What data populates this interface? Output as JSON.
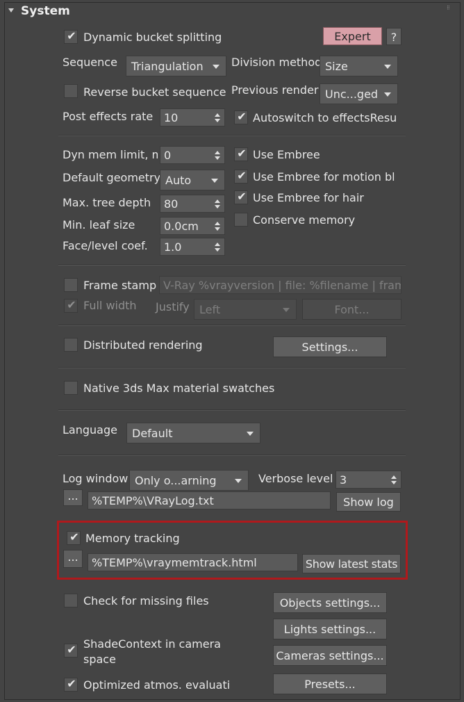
{
  "rollout": {
    "title": "System",
    "collapse_icon": "triangle-down-icon",
    "grip_icon": "drag-grip-icon"
  },
  "colors": {
    "panel": "#444444",
    "expert_button": "#d9a0a8",
    "highlight_box": "#b0191c"
  },
  "bucket": {
    "dynamic_splitting": {
      "label": "Dynamic bucket splitting",
      "checked": true
    },
    "expert_label": "Expert",
    "help_label": "?",
    "sequence": {
      "label": "Sequence",
      "value": "Triangulation"
    },
    "division_method": {
      "label": "Division method",
      "value": "Size"
    },
    "reverse": {
      "label": "Reverse bucket sequence",
      "checked": false
    },
    "previous_render": {
      "label": "Previous render",
      "value": "Unc...ged"
    },
    "post_effects_rate": {
      "label": "Post effects rate",
      "value": "10"
    },
    "autoswitch": {
      "label": "Autoswitch to effectsResult",
      "checked": true
    }
  },
  "memory": {
    "dyn_mem_limit": {
      "label": "Dyn mem limit, mb",
      "value": "0"
    },
    "default_geometry": {
      "label": "Default geometry",
      "value": "Auto"
    },
    "max_tree_depth": {
      "label": "Max. tree depth",
      "value": "80"
    },
    "min_leaf_size": {
      "label": "Min. leaf size",
      "value": "0.0cm"
    },
    "face_level_coef": {
      "label": "Face/level coef.",
      "value": "1.0"
    },
    "use_embree": {
      "label": "Use Embree",
      "checked": true
    },
    "use_embree_motion_blur": {
      "label": "Use Embree for motion blur",
      "checked": true
    },
    "use_embree_hair": {
      "label": "Use Embree for hair",
      "checked": true
    },
    "conserve_memory": {
      "label": "Conserve memory",
      "checked": false
    }
  },
  "frame_stamp": {
    "label": "Frame stamp",
    "checked": false,
    "text": "V-Ray %vrayversion | file: %filename | frame",
    "full_width": {
      "label": "Full width",
      "checked": true
    },
    "justify": {
      "label": "Justify",
      "value": "Left"
    },
    "font_label": "Font..."
  },
  "distributed": {
    "label": "Distributed rendering",
    "checked": false,
    "settings_label": "Settings..."
  },
  "swatches": {
    "label": "Native 3ds Max material swatches",
    "checked": false
  },
  "language": {
    "label": "Language",
    "value": "Default"
  },
  "log": {
    "label": "Log window",
    "value": "Only o...arning",
    "verbose_label": "Verbose level",
    "verbose_value": "3",
    "browse_label": "...",
    "path": "%TEMP%\\VRayLog.txt",
    "show_log_label": "Show log"
  },
  "memory_tracking": {
    "label": "Memory tracking",
    "checked": true,
    "browse_label": "...",
    "path": "%TEMP%\\vraymemtrack.html",
    "show_stats_label": "Show latest stats"
  },
  "misc": {
    "missing_files": {
      "label": "Check for missing files",
      "checked": false
    },
    "objects_settings": "Objects settings...",
    "lights_settings": "Lights settings...",
    "shade_context": {
      "label_line1": "ShadeContext in camera",
      "label_line2": "space",
      "checked": true
    },
    "cameras_settings": "Cameras settings...",
    "optimized_atmos": {
      "label": "Optimized atmos. evaluation",
      "checked": true
    },
    "presets": "Presets..."
  }
}
